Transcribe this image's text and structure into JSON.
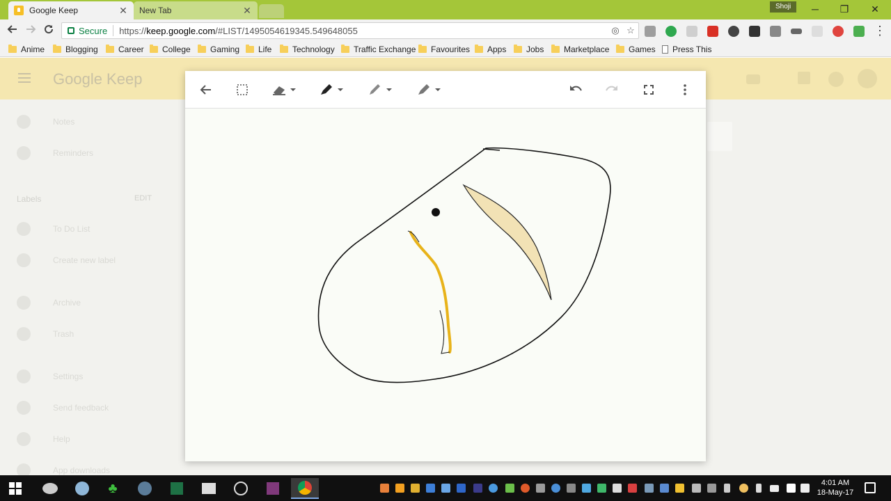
{
  "browser": {
    "tabs": [
      {
        "label": "Google Keep",
        "active": true
      },
      {
        "label": "New Tab",
        "active": false
      }
    ],
    "profile_name": "Shoji",
    "window_controls": {
      "minimize": "─",
      "maximize": "❐",
      "close": "✕"
    },
    "address": {
      "secure_label": "Secure",
      "url_scheme": "https://",
      "url_host": "keep.google.com",
      "url_rest": "/#LIST/1495054619345.549648055"
    },
    "bookmarks": [
      {
        "label": "Anime",
        "type": "folder"
      },
      {
        "label": "Blogging",
        "type": "folder"
      },
      {
        "label": "Career",
        "type": "folder"
      },
      {
        "label": "College",
        "type": "folder"
      },
      {
        "label": "Gaming",
        "type": "folder"
      },
      {
        "label": "Life",
        "type": "folder"
      },
      {
        "label": "Technology",
        "type": "folder"
      },
      {
        "label": "Traffic Exchange",
        "type": "folder"
      },
      {
        "label": "Favourites",
        "type": "folder"
      },
      {
        "label": "Apps",
        "type": "folder"
      },
      {
        "label": "Jobs",
        "type": "folder"
      },
      {
        "label": "Marketplace",
        "type": "folder"
      },
      {
        "label": "Games",
        "type": "folder"
      },
      {
        "label": "Press This",
        "type": "page"
      }
    ]
  },
  "keep": {
    "logo": "Google Keep",
    "sidebar": {
      "items_top": [
        {
          "label": "Notes",
          "icon": "lightbulb-icon"
        },
        {
          "label": "Reminders",
          "icon": "reminder-icon"
        }
      ],
      "labels_heading": "Labels",
      "labels_edit": "EDIT",
      "items_labels": [
        {
          "label": "To Do List",
          "icon": "label-icon"
        },
        {
          "label": "Create new label",
          "icon": "plus-icon"
        }
      ],
      "items_bottom": [
        {
          "label": "Archive",
          "icon": "archive-icon"
        },
        {
          "label": "Trash",
          "icon": "trash-icon"
        },
        {
          "label": "Settings",
          "icon": "settings-icon"
        },
        {
          "label": "Send feedback",
          "icon": "feedback-icon"
        },
        {
          "label": "Help",
          "icon": "help-icon"
        },
        {
          "label": "App downloads",
          "icon": "download-icon"
        }
      ]
    }
  },
  "drawing": {
    "toolbar": [
      "back-arrow-icon",
      "select-icon",
      "eraser-icon",
      "pen-icon",
      "marker-icon",
      "highlighter-icon",
      "undo-icon",
      "redo-icon",
      "fullscreen-icon",
      "more-icon"
    ],
    "colors": {
      "stroke": "#111111",
      "yellow": "#e8b31a",
      "highlight": "#f2e2b5"
    }
  },
  "taskbar": {
    "time": "4:01 AM",
    "date": "18-May-17"
  }
}
